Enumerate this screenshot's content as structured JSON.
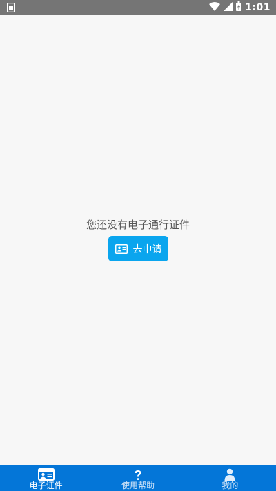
{
  "status_bar": {
    "time": "1:01",
    "left_icon": "sim-icon",
    "icons": [
      "wifi-icon",
      "signal-icon",
      "battery-charging-icon"
    ],
    "background": "#757575"
  },
  "empty_state": {
    "message": "您还没有电子通行证件",
    "apply_button": {
      "label": "去申请",
      "icon": "id-card-icon",
      "color": "#0aa5ee"
    }
  },
  "tab_bar": {
    "background": "#0476d8",
    "tabs": [
      {
        "label": "电子证件",
        "icon": "id-card-icon",
        "active": true
      },
      {
        "label": "使用帮助",
        "icon": "question-icon",
        "active": false
      },
      {
        "label": "我的",
        "icon": "user-icon",
        "active": false
      }
    ]
  }
}
